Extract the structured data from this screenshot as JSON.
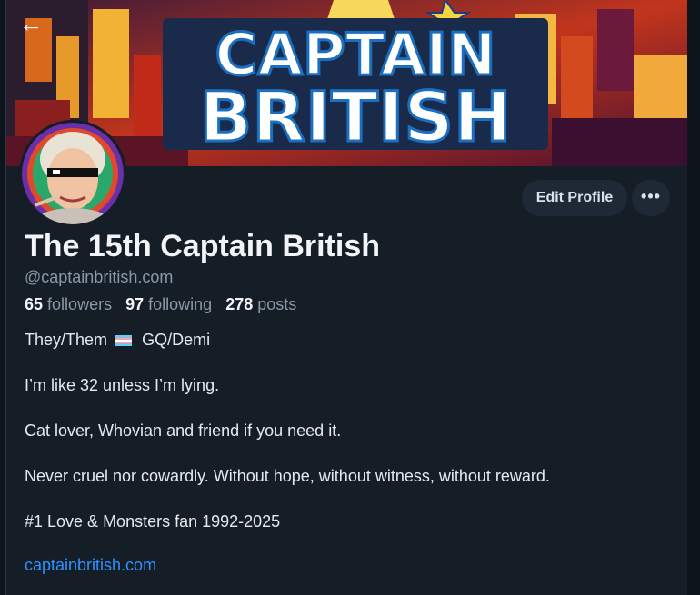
{
  "banner": {
    "line1": "CAPTAIN",
    "line2": "BRITISH"
  },
  "nav": {
    "back_icon": "arrow-left-icon",
    "back_glyph": "←"
  },
  "actions": {
    "edit_profile": "Edit Profile",
    "more_glyph": "•••"
  },
  "profile": {
    "display_name": "The 15th Captain British",
    "handle": "@captainbritish.com",
    "stats": {
      "followers_count": "65",
      "followers_label": "followers",
      "following_count": "97",
      "following_label": "following",
      "posts_count": "278",
      "posts_label": "posts"
    },
    "bio": {
      "pronouns": "They/Them",
      "pronouns_suffix": "GQ/Demi",
      "line2": "I’m like 32 unless I’m lying.",
      "line3": "Cat lover, Whovian and friend if you need it.",
      "line4": "Never cruel nor cowardly. Without hope, without witness, without reward.",
      "line5": "#1 Love & Monsters fan 1992-2025"
    },
    "website": "captainbritish.com"
  },
  "colors": {
    "background": "#151d27",
    "link": "#2d92ff",
    "button": "#1e2935"
  }
}
